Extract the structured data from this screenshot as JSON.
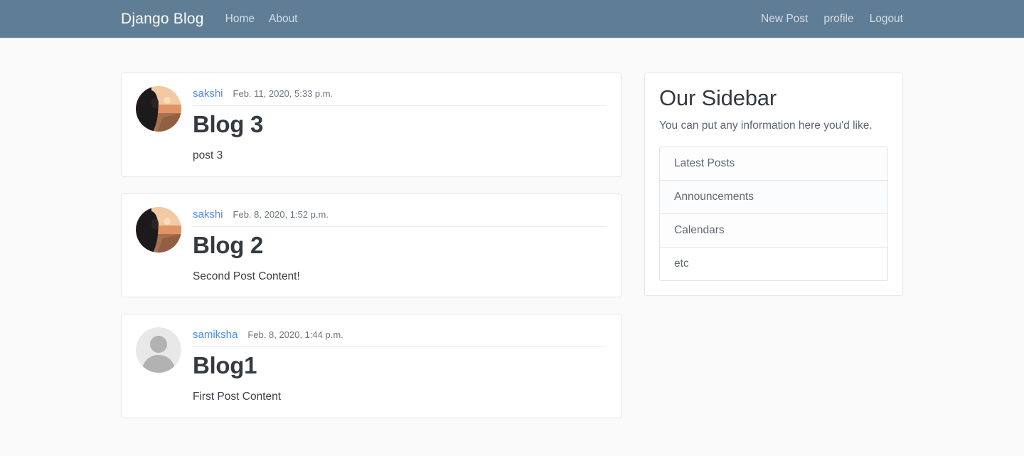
{
  "navbar": {
    "brand": "Django Blog",
    "left_links": [
      {
        "label": "Home",
        "name": "nav-link-home"
      },
      {
        "label": "About",
        "name": "nav-link-about"
      }
    ],
    "right_links": [
      {
        "label": "New Post",
        "name": "nav-link-new-post"
      },
      {
        "label": "profile",
        "name": "nav-link-profile"
      },
      {
        "label": "Logout",
        "name": "nav-link-logout"
      }
    ],
    "background_color": "#5f7d95",
    "brand_color": "#ffffff",
    "link_color": "#d5dde4"
  },
  "posts": [
    {
      "author": "sakshi",
      "date": "Feb. 11, 2020, 5:33 p.m.",
      "title": "Blog 3",
      "content": "post 3",
      "avatar": "photo-avatar-sunset"
    },
    {
      "author": "sakshi",
      "date": "Feb. 8, 2020, 1:52 p.m.",
      "title": "Blog 2",
      "content": "Second Post Content!",
      "avatar": "photo-avatar-sunset"
    },
    {
      "author": "samiksha",
      "date": "Feb. 8, 2020, 1:44 p.m.",
      "title": "Blog1",
      "content": "First Post Content",
      "avatar": "default-person-avatar"
    }
  ],
  "sidebar": {
    "title": "Our Sidebar",
    "description": "You can put any information here you'd like.",
    "items": [
      {
        "label": "Latest Posts"
      },
      {
        "label": "Announcements"
      },
      {
        "label": "Calendars"
      },
      {
        "label": "etc"
      }
    ]
  },
  "colors": {
    "page_background": "#fafafa",
    "card_background": "#ffffff",
    "card_border": "#e6e6e6",
    "link_accent": "#4c8bf5",
    "heading": "#343a40",
    "muted_text": "#6c757d"
  }
}
